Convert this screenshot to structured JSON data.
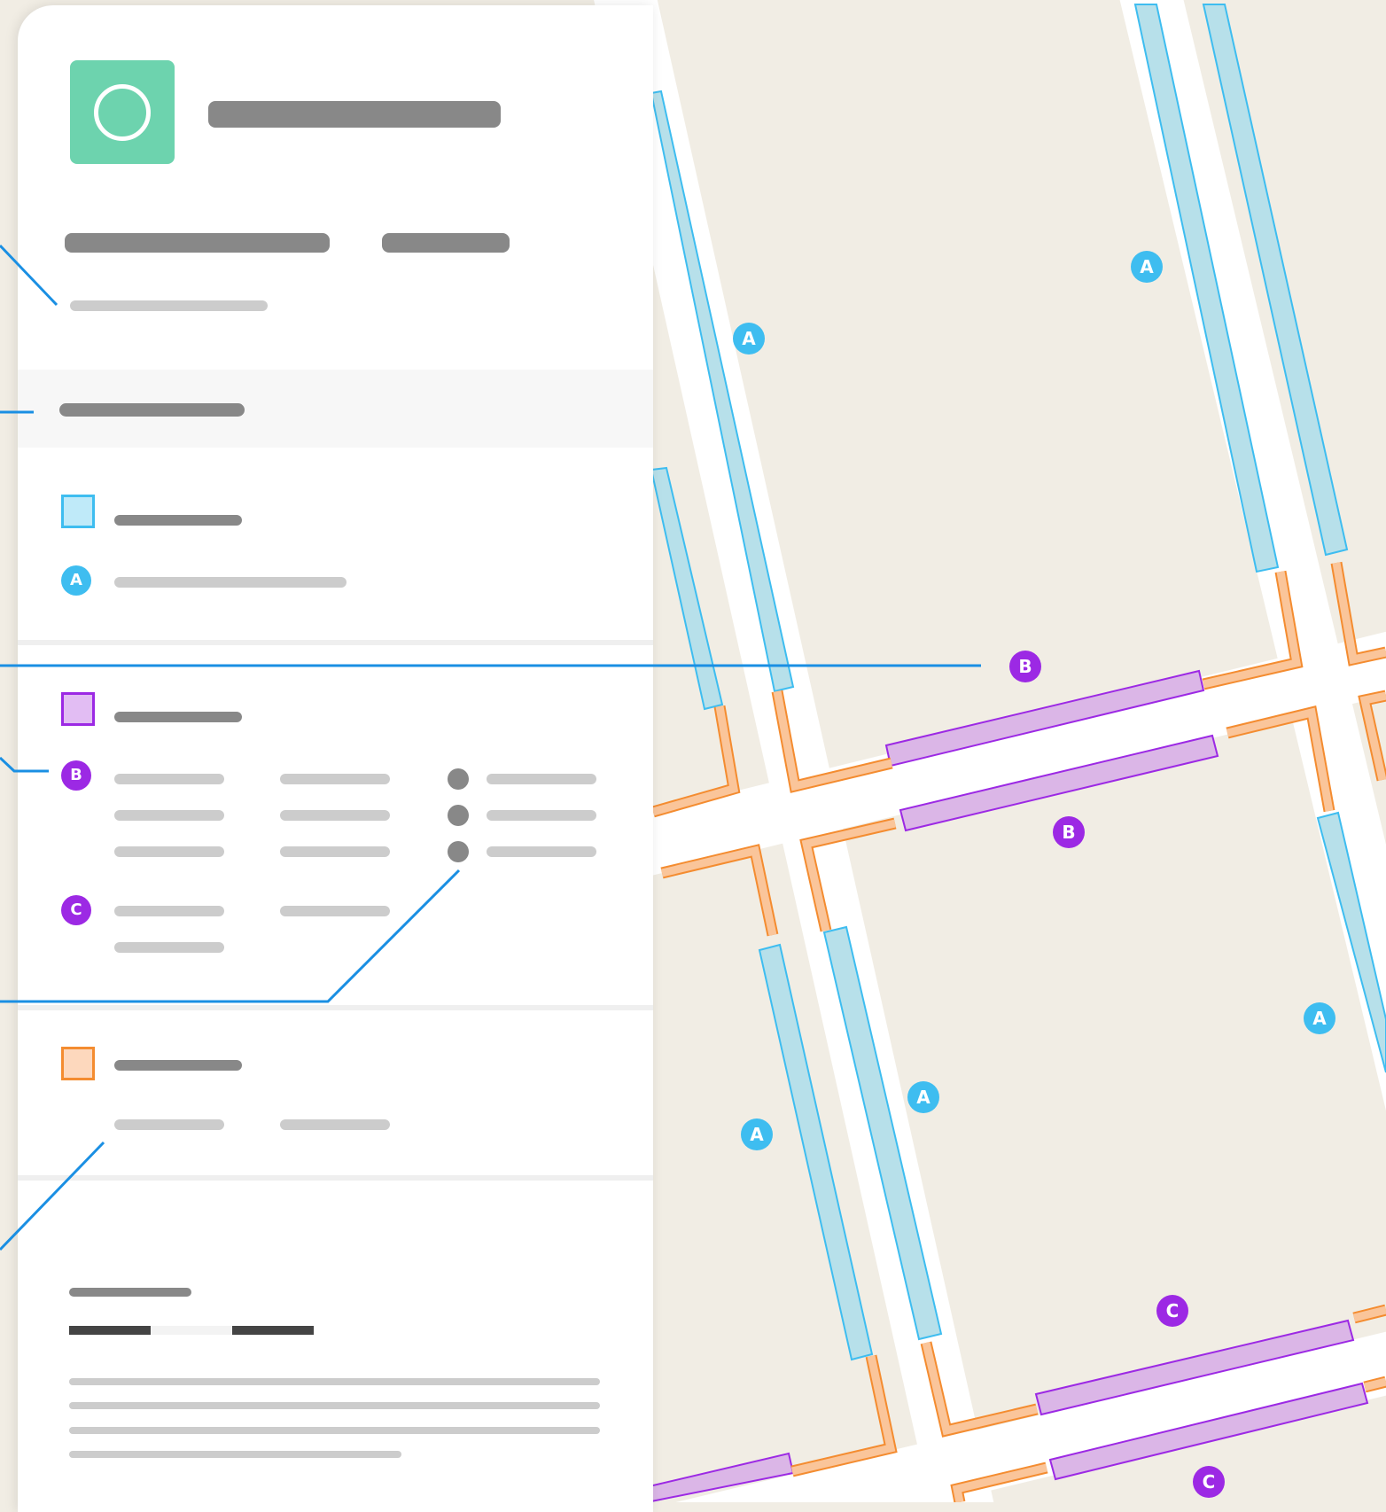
{
  "colors": {
    "map_background": "#f1ede4",
    "street": "#ffffff",
    "zone_a_fill": "#b7e0ea",
    "zone_a_stroke": "#3ebdf0",
    "zone_b_fill": "#dbb6e7",
    "zone_b_stroke": "#9c29e4",
    "curb_fill": "#fac59a",
    "curb_stroke": "#f48c30",
    "brand": "#6dd3ae",
    "leader_line": "#1a8fe3"
  },
  "panel": {
    "app_icon": "circle-icon",
    "legend": [
      {
        "swatch": "zone-a",
        "badges": [
          "A"
        ]
      },
      {
        "swatch": "zone-b",
        "badges": [
          "B",
          "C"
        ]
      },
      {
        "swatch": "curb",
        "badges": []
      }
    ]
  },
  "map": {
    "badges": {
      "a1": "A",
      "a2": "A",
      "a3": "A",
      "a4": "A",
      "a5": "A",
      "b1": "B",
      "b2": "B",
      "c1": "C",
      "c2": "C"
    }
  }
}
